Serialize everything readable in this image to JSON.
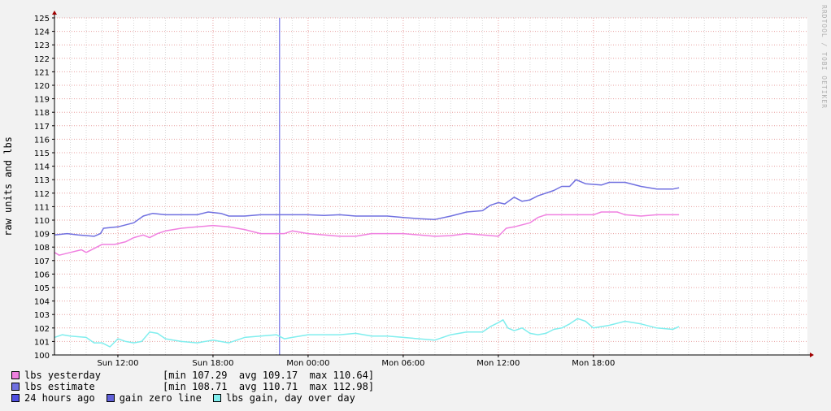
{
  "credit": "RRDTOOL / TOBI OETIKER",
  "legend": [
    {
      "label": "lbs yesterday",
      "color": "#f080e0",
      "stats": "[min 107.29  avg 109.17  max 110.64]"
    },
    {
      "label": "lbs estimate",
      "color": "#7070e0",
      "stats": "[min 108.71  avg 110.71  max 112.98]"
    }
  ],
  "legend_row3": [
    {
      "label": "24 hours ago",
      "color": "#5050e0"
    },
    {
      "label": "gain zero line",
      "color": "#6060d8"
    },
    {
      "label": "lbs gain, day over day",
      "color": "#80eeee"
    }
  ],
  "chart_data": {
    "type": "line",
    "ylabel": "raw units and lbs",
    "ylim": [
      100,
      125
    ],
    "yticks": [
      100,
      101,
      102,
      103,
      104,
      105,
      106,
      107,
      108,
      109,
      110,
      111,
      112,
      113,
      114,
      115,
      116,
      117,
      118,
      119,
      120,
      121,
      122,
      123,
      124,
      125
    ],
    "xlim": [
      8.0,
      55.5
    ],
    "x_ticks": [
      {
        "t": 12,
        "label": "Sun 12:00"
      },
      {
        "t": 18,
        "label": "Sun 18:00"
      },
      {
        "t": 24,
        "label": "Mon 00:00"
      },
      {
        "t": 30,
        "label": "Mon 06:00"
      },
      {
        "t": 36,
        "label": "Mon 12:00"
      },
      {
        "t": 42,
        "label": "Mon 18:00"
      }
    ],
    "vline": {
      "t": 22.2,
      "color": "#5050e0"
    },
    "series": [
      {
        "name": "lbs estimate",
        "color": "#7070e0",
        "points": [
          [
            8.0,
            108.9
          ],
          [
            8.8,
            109.0
          ],
          [
            9.5,
            108.9
          ],
          [
            10.5,
            108.8
          ],
          [
            10.9,
            109.0
          ],
          [
            11.1,
            109.4
          ],
          [
            12.0,
            109.5
          ],
          [
            13.0,
            109.8
          ],
          [
            13.6,
            110.3
          ],
          [
            14.2,
            110.5
          ],
          [
            15.0,
            110.4
          ],
          [
            16.0,
            110.4
          ],
          [
            17.0,
            110.4
          ],
          [
            17.7,
            110.6
          ],
          [
            18.5,
            110.5
          ],
          [
            19.0,
            110.3
          ],
          [
            20.0,
            110.3
          ],
          [
            21.0,
            110.4
          ],
          [
            22.0,
            110.4
          ],
          [
            23.0,
            110.4
          ],
          [
            24.0,
            110.4
          ],
          [
            25.0,
            110.35
          ],
          [
            26.0,
            110.4
          ],
          [
            27.0,
            110.3
          ],
          [
            28.0,
            110.3
          ],
          [
            29.0,
            110.3
          ],
          [
            30.0,
            110.2
          ],
          [
            31.0,
            110.1
          ],
          [
            32.0,
            110.05
          ],
          [
            33.0,
            110.3
          ],
          [
            34.0,
            110.6
          ],
          [
            35.0,
            110.7
          ],
          [
            35.5,
            111.1
          ],
          [
            36.0,
            111.3
          ],
          [
            36.4,
            111.2
          ],
          [
            37.0,
            111.7
          ],
          [
            37.5,
            111.4
          ],
          [
            38.0,
            111.5
          ],
          [
            38.5,
            111.8
          ],
          [
            39.5,
            112.2
          ],
          [
            40.0,
            112.5
          ],
          [
            40.5,
            112.5
          ],
          [
            40.9,
            113.0
          ],
          [
            41.5,
            112.7
          ],
          [
            42.5,
            112.6
          ],
          [
            43.0,
            112.8
          ],
          [
            44.0,
            112.8
          ],
          [
            45.0,
            112.5
          ],
          [
            46.0,
            112.3
          ],
          [
            47.0,
            112.3
          ],
          [
            47.4,
            112.4
          ]
        ]
      },
      {
        "name": "lbs yesterday",
        "color": "#f080e0",
        "points": [
          [
            8.0,
            107.6
          ],
          [
            8.3,
            107.4
          ],
          [
            9.0,
            107.6
          ],
          [
            9.7,
            107.8
          ],
          [
            10.0,
            107.6
          ],
          [
            10.5,
            107.9
          ],
          [
            11.0,
            108.2
          ],
          [
            11.8,
            108.2
          ],
          [
            12.5,
            108.4
          ],
          [
            13.0,
            108.7
          ],
          [
            13.6,
            108.9
          ],
          [
            14.0,
            108.7
          ],
          [
            14.5,
            109.0
          ],
          [
            15.0,
            109.2
          ],
          [
            16.0,
            109.4
          ],
          [
            17.0,
            109.5
          ],
          [
            18.0,
            109.6
          ],
          [
            19.0,
            109.5
          ],
          [
            20.0,
            109.3
          ],
          [
            21.0,
            109.0
          ],
          [
            22.0,
            109.0
          ],
          [
            22.5,
            109.0
          ],
          [
            23.0,
            109.2
          ],
          [
            24.0,
            109.0
          ],
          [
            25.0,
            108.9
          ],
          [
            26.0,
            108.8
          ],
          [
            27.0,
            108.8
          ],
          [
            28.0,
            109.0
          ],
          [
            29.0,
            109.0
          ],
          [
            30.0,
            109.0
          ],
          [
            31.0,
            108.9
          ],
          [
            32.0,
            108.8
          ],
          [
            33.0,
            108.85
          ],
          [
            34.0,
            109.0
          ],
          [
            35.0,
            108.9
          ],
          [
            36.0,
            108.8
          ],
          [
            36.5,
            109.4
          ],
          [
            37.0,
            109.5
          ],
          [
            38.0,
            109.8
          ],
          [
            38.5,
            110.2
          ],
          [
            39.0,
            110.4
          ],
          [
            40.0,
            110.4
          ],
          [
            41.0,
            110.4
          ],
          [
            42.0,
            110.4
          ],
          [
            42.5,
            110.6
          ],
          [
            43.5,
            110.6
          ],
          [
            44.0,
            110.4
          ],
          [
            45.0,
            110.3
          ],
          [
            46.0,
            110.4
          ],
          [
            47.0,
            110.4
          ],
          [
            47.4,
            110.4
          ]
        ]
      },
      {
        "name": "lbs gain, day over day",
        "color": "#80eeee",
        "points": [
          [
            8.0,
            101.3
          ],
          [
            8.5,
            101.5
          ],
          [
            9.0,
            101.4
          ],
          [
            10.0,
            101.3
          ],
          [
            10.5,
            100.9
          ],
          [
            11.0,
            100.9
          ],
          [
            11.5,
            100.6
          ],
          [
            12.0,
            101.2
          ],
          [
            12.5,
            101.0
          ],
          [
            13.0,
            100.9
          ],
          [
            13.5,
            101.0
          ],
          [
            14.0,
            101.7
          ],
          [
            14.5,
            101.6
          ],
          [
            15.0,
            101.2
          ],
          [
            16.0,
            101.0
          ],
          [
            17.0,
            100.9
          ],
          [
            18.0,
            101.1
          ],
          [
            19.0,
            100.9
          ],
          [
            20.0,
            101.3
          ],
          [
            21.0,
            101.4
          ],
          [
            22.0,
            101.5
          ],
          [
            22.5,
            101.2
          ],
          [
            23.0,
            101.3
          ],
          [
            24.0,
            101.5
          ],
          [
            25.0,
            101.5
          ],
          [
            26.0,
            101.5
          ],
          [
            27.0,
            101.6
          ],
          [
            28.0,
            101.4
          ],
          [
            29.0,
            101.4
          ],
          [
            30.0,
            101.3
          ],
          [
            31.0,
            101.2
          ],
          [
            32.0,
            101.1
          ],
          [
            33.0,
            101.5
          ],
          [
            34.0,
            101.7
          ],
          [
            35.0,
            101.7
          ],
          [
            35.5,
            102.1
          ],
          [
            36.0,
            102.4
          ],
          [
            36.3,
            102.6
          ],
          [
            36.6,
            102.0
          ],
          [
            37.0,
            101.8
          ],
          [
            37.5,
            102.0
          ],
          [
            38.0,
            101.6
          ],
          [
            38.5,
            101.5
          ],
          [
            39.0,
            101.6
          ],
          [
            39.5,
            101.9
          ],
          [
            40.0,
            102.0
          ],
          [
            40.5,
            102.3
          ],
          [
            41.0,
            102.7
          ],
          [
            41.5,
            102.5
          ],
          [
            42.0,
            102.0
          ],
          [
            43.0,
            102.2
          ],
          [
            44.0,
            102.5
          ],
          [
            45.0,
            102.3
          ],
          [
            46.0,
            102.0
          ],
          [
            47.0,
            101.9
          ],
          [
            47.4,
            102.1
          ]
        ]
      }
    ]
  }
}
